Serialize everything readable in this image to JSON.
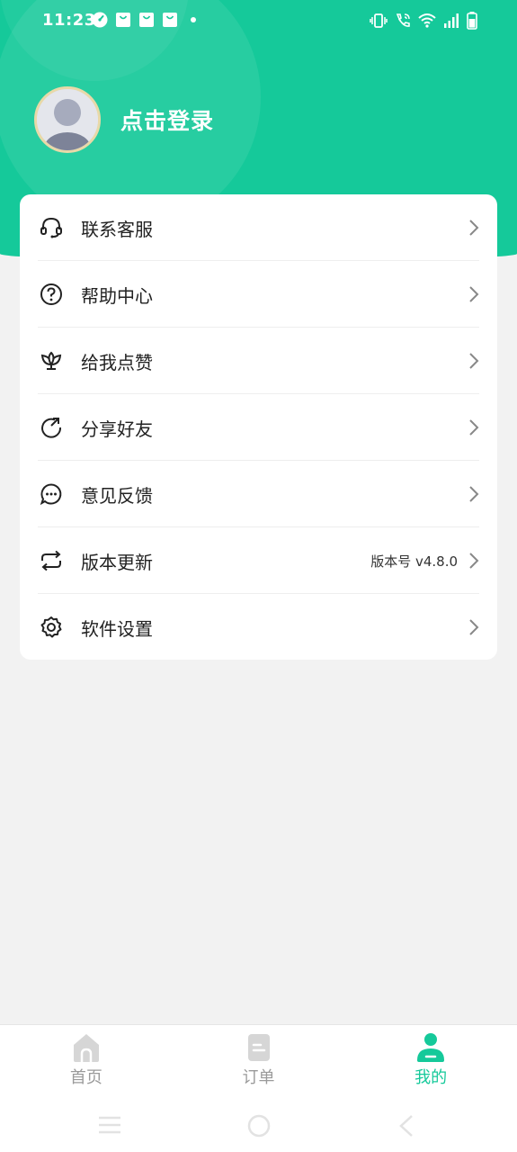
{
  "status_bar": {
    "time": "11:23",
    "left_icons": [
      "speedometer-icon",
      "shopping-bag-icon",
      "shopping-bag-icon",
      "shopping-bag-icon",
      "notification-dot-icon"
    ],
    "right_icons": [
      "vibrate-icon",
      "wifi-call-icon",
      "wifi-icon",
      "signal-icon",
      "battery-icon"
    ]
  },
  "profile": {
    "login_text": "点击登录"
  },
  "menu": [
    {
      "label": "联系客服",
      "icon": "headset-icon"
    },
    {
      "label": "帮助中心",
      "icon": "help-circle-icon"
    },
    {
      "label": "给我点赞",
      "icon": "lotus-icon"
    },
    {
      "label": "分享好友",
      "icon": "share-icon"
    },
    {
      "label": "意见反馈",
      "icon": "chat-bubble-icon"
    },
    {
      "label": "版本更新",
      "icon": "refresh-icon",
      "extra": "版本号 v4.8.0"
    },
    {
      "label": "软件设置",
      "icon": "gear-icon"
    }
  ],
  "tabs": [
    {
      "label": "首页",
      "icon": "home-icon",
      "active": false
    },
    {
      "label": "订单",
      "icon": "order-icon",
      "active": false
    },
    {
      "label": "我的",
      "icon": "profile-icon",
      "active": true
    }
  ],
  "colors": {
    "accent": "#15c99a",
    "background": "#f2f2f2",
    "inactive_tab": "#9a9a9a"
  }
}
